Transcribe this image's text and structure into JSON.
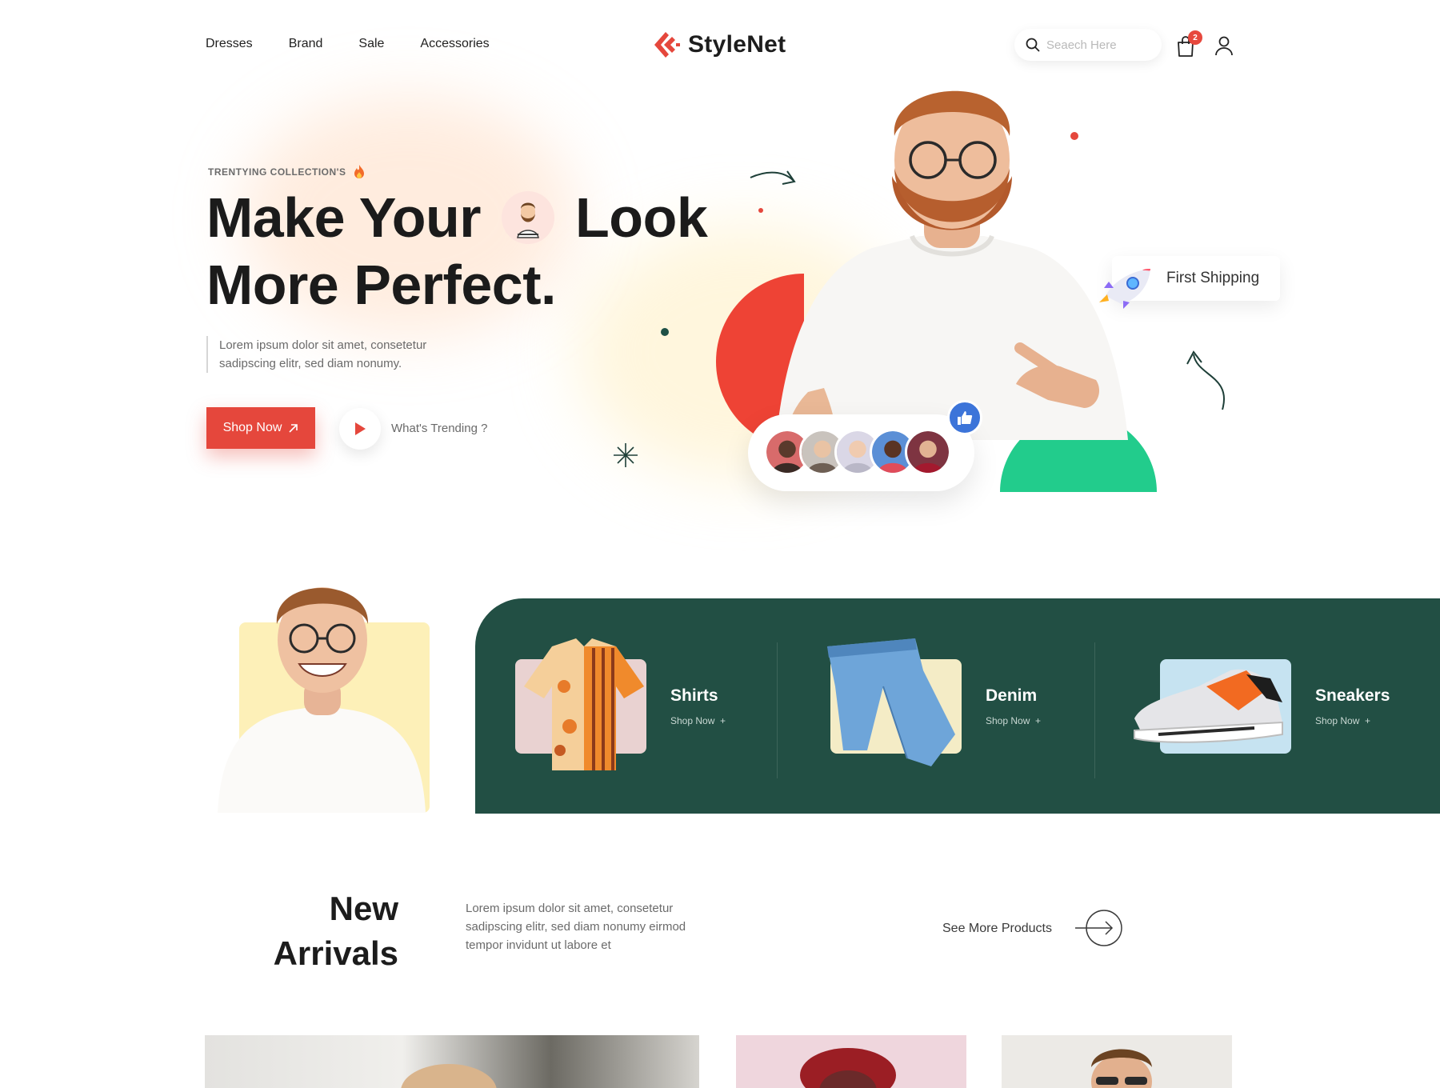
{
  "nav": {
    "links": [
      "Dresses",
      "Brand",
      "Sale",
      "Accessories"
    ],
    "logo_text": "StyleNet",
    "search_placeholder": "Seaech Here",
    "cart_count": "2"
  },
  "hero": {
    "eyebrow": "TRENTYING COLLECTION'S",
    "title_part1": "Make Your",
    "title_part2": "Look",
    "title_line2": "More Perfect.",
    "description": "Lorem ipsum dolor sit amet, consetetur sadipscing elitr, sed diam nonumy.",
    "shop_button": "Shop Now",
    "trending_link": "What's Trending ?",
    "shipping_badge": "First Shipping"
  },
  "categories": [
    {
      "name": "Shirts",
      "link": "Shop Now"
    },
    {
      "name": "Denim",
      "link": "Shop Now"
    },
    {
      "name": "Sneakers",
      "link": "Shop Now"
    }
  ],
  "new_arrivals": {
    "title_line1": "New",
    "title_line2": "Arrivals",
    "description": "Lorem ipsum dolor sit amet, consetetur sadipscing elitr, sed diam nonumy eirmod tempor invidunt ut labore et",
    "see_more": "See More Products"
  },
  "colors": {
    "accent": "#e5473c",
    "band": "#224f44",
    "green": "#22cc8c",
    "yellow_card": "#fdf0b8"
  }
}
